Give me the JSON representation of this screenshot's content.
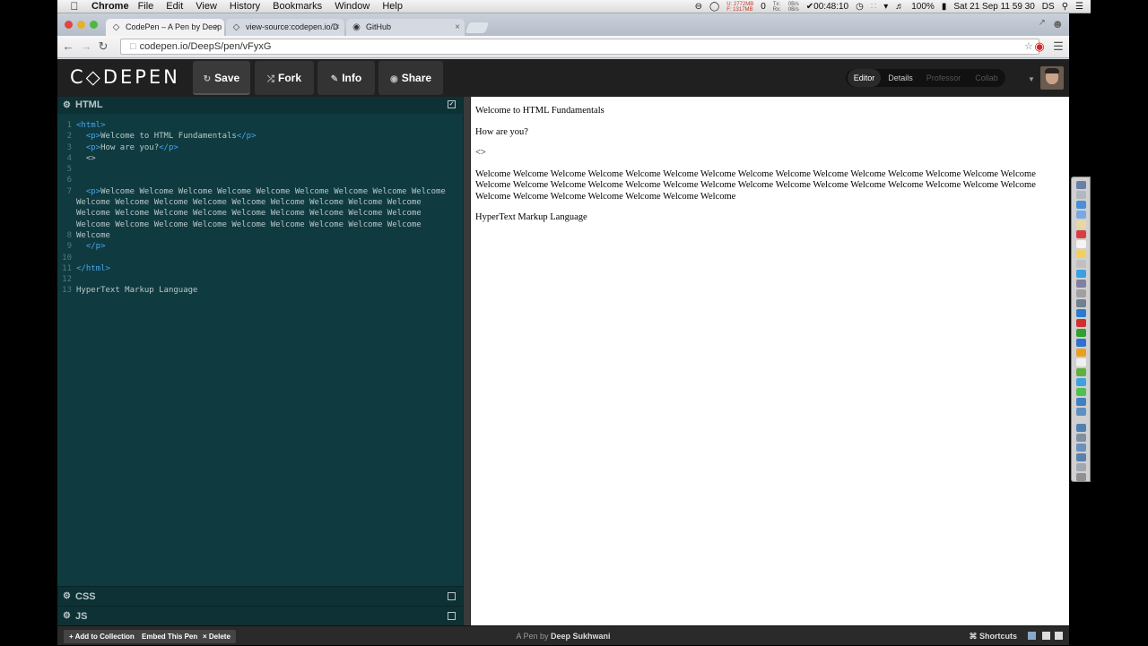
{
  "menubar": {
    "apple": "",
    "app": "Chrome",
    "items": [
      "File",
      "Edit",
      "View",
      "History",
      "Bookmarks",
      "Window",
      "Help"
    ],
    "stat_u": "U: 2772MB",
    "stat_f": "F: 1317MB",
    "stat_zero": "0",
    "stat_tx": "Tx:",
    "stat_rx": "Rx:",
    "stat_rate1": "0B/s",
    "stat_rate2": "0B/s",
    "timer": "00:48:10",
    "battery": "100%",
    "datetime": "Sat 21 Sep  11 59 30",
    "user": "DS"
  },
  "tabs": [
    {
      "label": "CodePen – A Pen by Deep",
      "icon": "codepen-icon"
    },
    {
      "label": "view-source:codepen.io/D",
      "icon": "codepen-icon"
    },
    {
      "label": "GitHub",
      "icon": "github-icon"
    }
  ],
  "address": {
    "url": "codepen.io/DeepS/pen/vFyxG"
  },
  "header": {
    "logo": "C◇DEPEN",
    "save": "Save",
    "fork": "Fork",
    "info": "Info",
    "share": "Share",
    "views": [
      "Editor",
      "Details",
      "Professor",
      "Collab"
    ]
  },
  "editor": {
    "html_title": "HTML",
    "css_title": "CSS",
    "js_title": "JS",
    "line_numbers": [
      "1",
      "2",
      "3",
      "4",
      "5",
      "6",
      "7",
      "",
      "",
      "",
      "8",
      "9",
      "10",
      "11",
      "12",
      "13"
    ],
    "lines": [
      "<html>",
      "  <p>Welcome to HTML Fundamentals</p>",
      "  <p>How are you?</p>",
      "  <>",
      "",
      "",
      "  <p>Welcome Welcome Welcome Welcome Welcome Welcome Welcome Welcome Welcome Welcome Welcome Welcome Welcome Welcome Welcome Welcome Welcome Welcome Welcome Welcome Welcome Welcome Welcome Welcome Welcome Welcome Welcome Welcome Welcome Welcome Welcome Welcome Welcome Welcome Welcome Welcome Welcome",
      "  </p>",
      "",
      "</html>",
      "",
      "HyperText Markup Language",
      ""
    ]
  },
  "preview": {
    "p1": "Welcome to HTML Fundamentals",
    "p2": "How are you?",
    "p3": "<>",
    "p4": "Welcome Welcome Welcome Welcome Welcome Welcome Welcome Welcome Welcome Welcome Welcome Welcome Welcome Welcome Welcome Welcome Welcome Welcome Welcome Welcome Welcome Welcome Welcome Welcome Welcome Welcome Welcome Welcome Welcome Welcome Welcome Welcome Welcome Welcome Welcome Welcome Welcome",
    "p5": "HyperText Markup Language"
  },
  "footer": {
    "add": "+ Add to Collection",
    "embed": "Embed This Pen",
    "delete": "× Delete",
    "by_prefix": "A Pen by",
    "author": "Deep Sukhwani",
    "shortcuts": "⌘ Shortcuts"
  }
}
